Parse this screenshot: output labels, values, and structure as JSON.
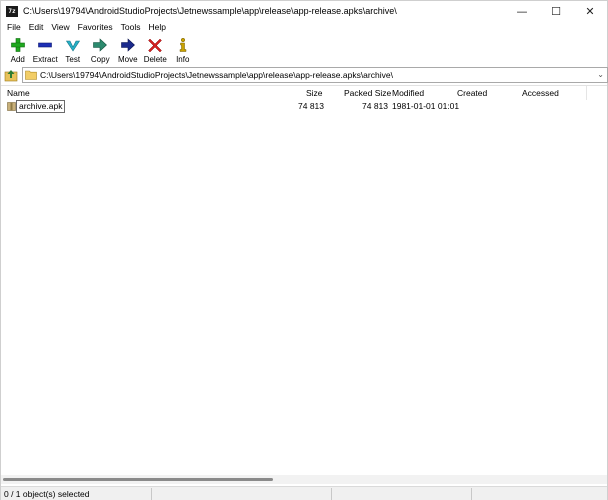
{
  "window": {
    "app_icon_text": "7z",
    "title": "C:\\Users\\19794\\AndroidStudioProjects\\Jetnewssample\\app\\release\\app-release.apks\\archive\\",
    "controls": {
      "minimize": "—",
      "maximize": "☐",
      "close": "✕"
    }
  },
  "menu": {
    "items": [
      "File",
      "Edit",
      "View",
      "Favorites",
      "Tools",
      "Help"
    ]
  },
  "toolbar": {
    "buttons": [
      {
        "label": "Add",
        "icon": "plus-icon",
        "color": "#1fa81f"
      },
      {
        "label": "Extract",
        "icon": "minus-icon",
        "color": "#1d2fb5"
      },
      {
        "label": "Test",
        "icon": "check-icon",
        "color": "#27b0c6"
      },
      {
        "label": "Copy",
        "icon": "arrow-right-icon",
        "color": "#2c8a6e"
      },
      {
        "label": "Move",
        "icon": "arrow-right-icon",
        "color": "#1b2a8c"
      },
      {
        "label": "Delete",
        "icon": "x-icon",
        "color": "#d32020"
      },
      {
        "label": "Info",
        "icon": "info-icon",
        "color": "#c9a200"
      }
    ]
  },
  "address": {
    "path": "C:\\Users\\19794\\AndroidStudioProjects\\Jetnewssample\\app\\release\\app-release.apks\\archive\\",
    "dropdown": "⌄"
  },
  "list": {
    "columns": [
      "Name",
      "Size",
      "Packed Size",
      "Modified",
      "Created",
      "Accessed"
    ],
    "rows": [
      {
        "name": "archive.apk",
        "size": "74 813",
        "packed": "74 813",
        "modified": "1981-01-01 01:01",
        "created": "",
        "accessed": ""
      }
    ]
  },
  "status": {
    "text": "0 / 1 object(s) selected"
  }
}
